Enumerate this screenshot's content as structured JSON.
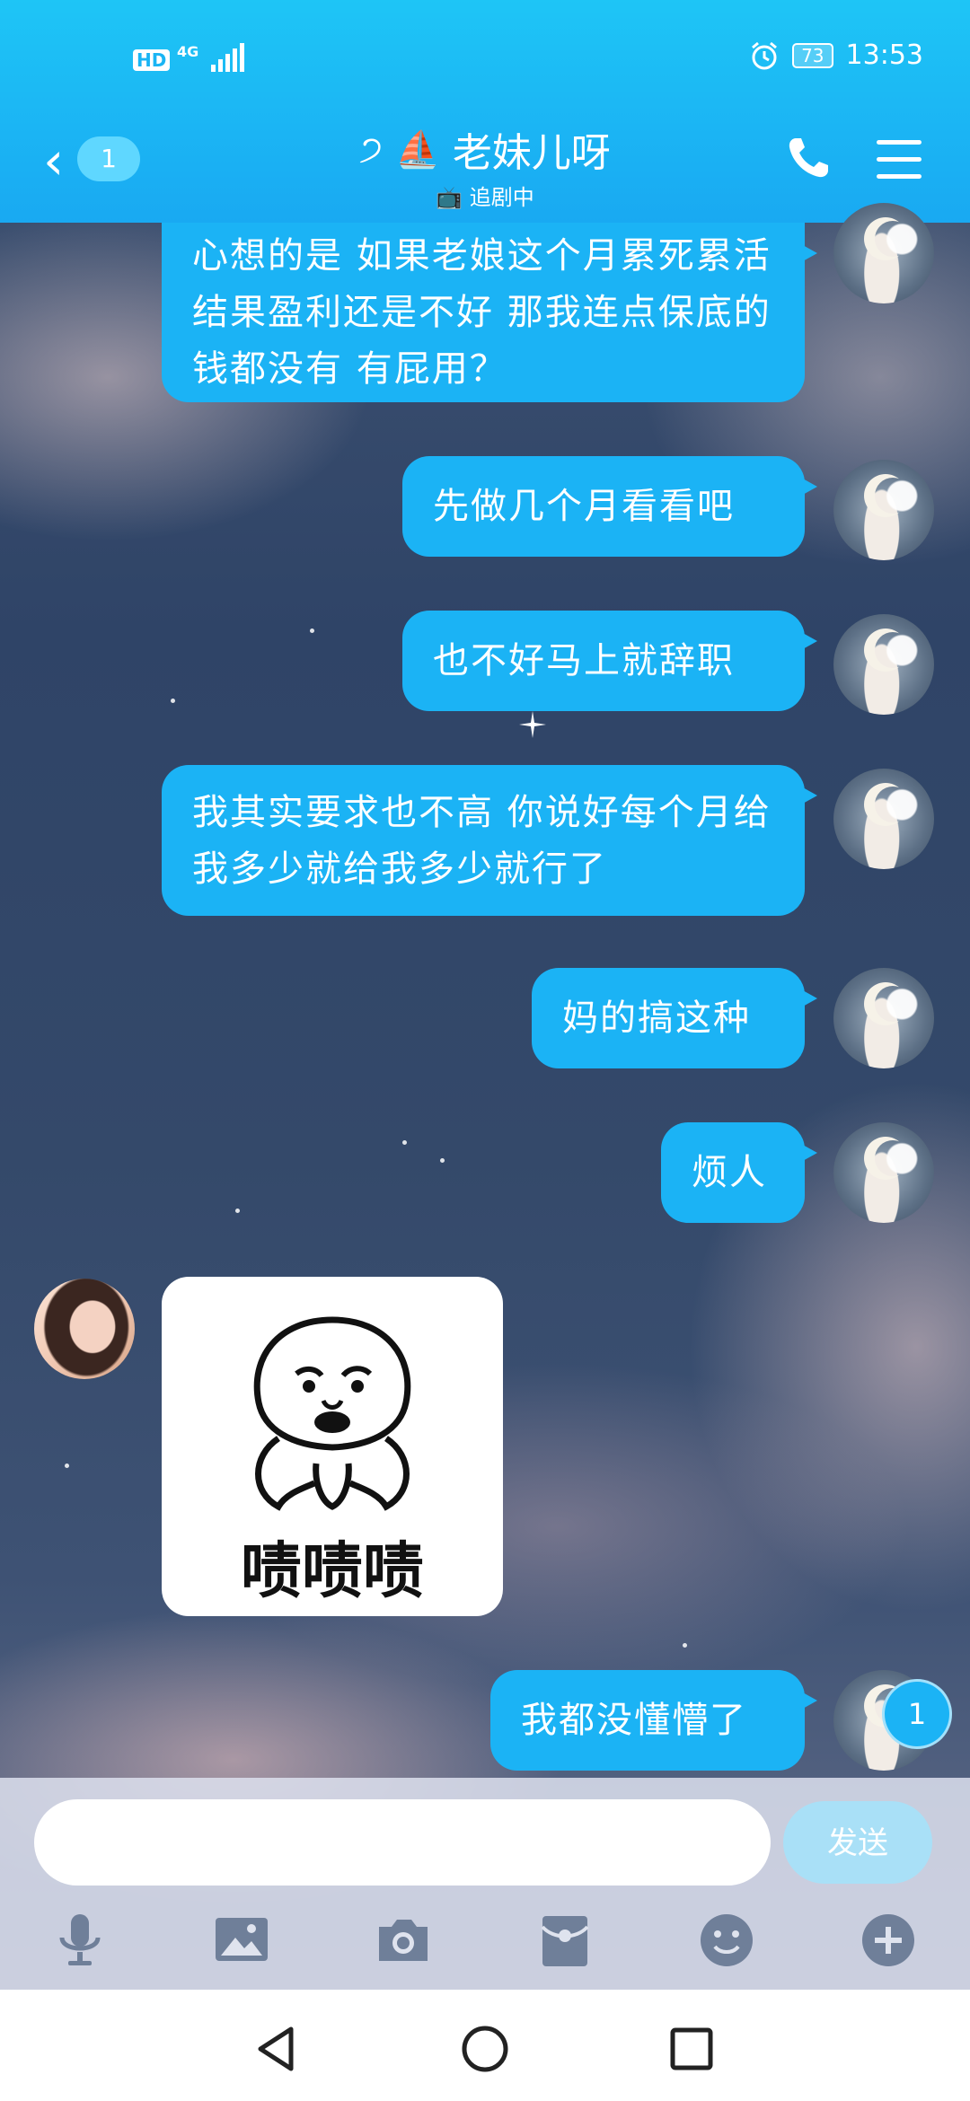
{
  "status_bar": {
    "network_badge": "HD",
    "network_type": "4G",
    "battery": "73",
    "time": "13:53"
  },
  "header": {
    "back_unread": "1",
    "title": "老妹儿呀",
    "subtitle": "追剧中"
  },
  "messages": [
    {
      "side": "right",
      "type": "text",
      "text": "心想的是 如果老娘这个月累死累活 结果盈利还是不好 那我连点保底的钱都没有 有屁用？"
    },
    {
      "side": "right",
      "type": "text",
      "text": "先做几个月看看吧"
    },
    {
      "side": "right",
      "type": "text",
      "text": "也不好马上就辞职"
    },
    {
      "side": "right",
      "type": "text",
      "text": "我其实要求也不高 你说好每个月给我多少就给我多少就行了"
    },
    {
      "side": "right",
      "type": "text",
      "text": "妈的搞这种"
    },
    {
      "side": "right",
      "type": "text",
      "text": "烦人"
    },
    {
      "side": "left",
      "type": "sticker",
      "text": "啧啧啧"
    },
    {
      "side": "right",
      "type": "text",
      "text": "我都没懂懵了"
    }
  ],
  "unread_badge": "1",
  "input": {
    "value": "",
    "placeholder": "",
    "send_label": "发送"
  },
  "toolbar": [
    "microphone-icon",
    "image-icon",
    "camera-icon",
    "red-packet-icon",
    "emoji-icon",
    "plus-icon"
  ],
  "colors": {
    "header": "#19a9f2",
    "bubble": "#1bb3f5",
    "send_disabled": "#a9e0f7"
  }
}
